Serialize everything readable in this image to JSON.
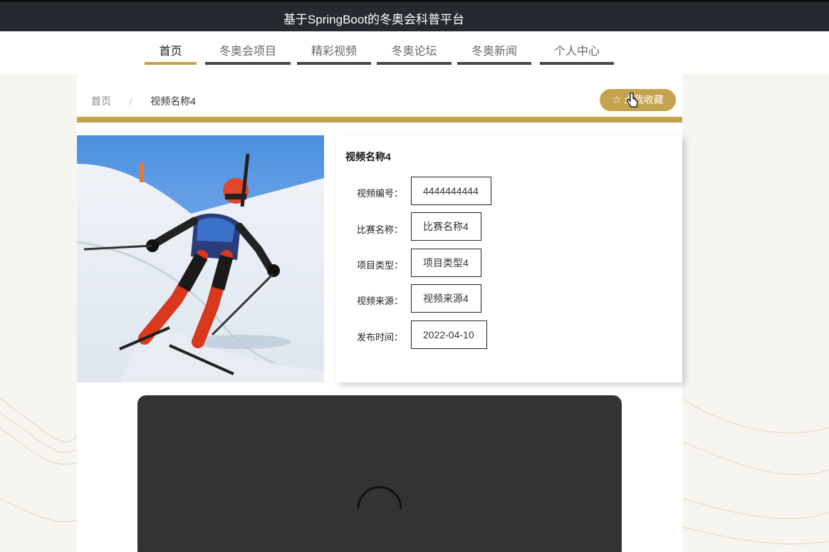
{
  "header": {
    "title": "基于SpringBoot的冬奥会科普平台"
  },
  "nav": {
    "items": [
      {
        "label": "首页",
        "active": true
      },
      {
        "label": "冬奥会项目",
        "active": false
      },
      {
        "label": "精彩视频",
        "active": false
      },
      {
        "label": "冬奥论坛",
        "active": false
      },
      {
        "label": "冬奥新闻",
        "active": false
      },
      {
        "label": "个人中心",
        "active": false
      }
    ]
  },
  "breadcrumb": {
    "home": "首页",
    "separator": "/",
    "current": "视频名称4"
  },
  "favorite_button": {
    "icon": "star-outline-icon",
    "label": "点我收藏"
  },
  "detail": {
    "title": "视频名称4",
    "fields": [
      {
        "label": "视频编号：",
        "value": "4444444444"
      },
      {
        "label": "比赛名称：",
        "value": "比赛名称4"
      },
      {
        "label": "项目类型：",
        "value": "项目类型4"
      },
      {
        "label": "视频来源：",
        "value": "视频来源4"
      },
      {
        "label": "发布时间：",
        "value": "2022-04-10"
      }
    ]
  },
  "video_player": {
    "state": "loading"
  },
  "colors": {
    "accent": "#c4a24e",
    "topbar": "#252a31",
    "player": "#333333"
  }
}
